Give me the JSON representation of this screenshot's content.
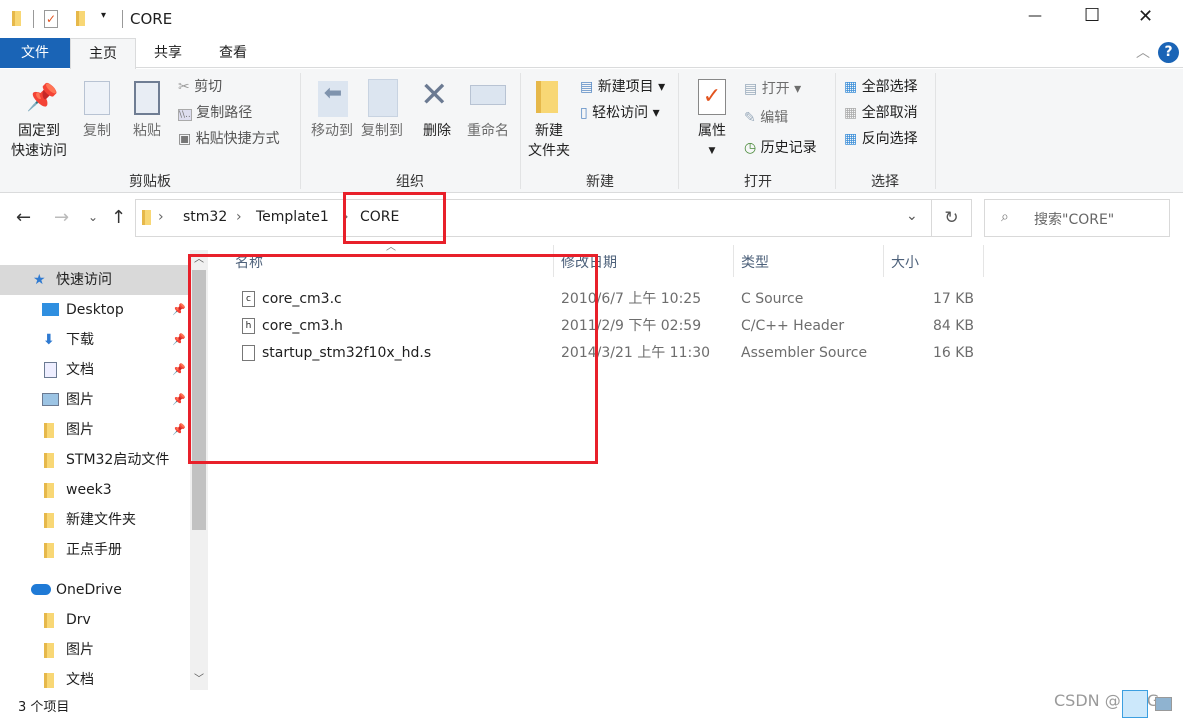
{
  "window": {
    "title": "CORE",
    "minimize": "—",
    "maximize": "☐",
    "close": "✕"
  },
  "tabs": {
    "file": "文件",
    "home": "主页",
    "share": "共享",
    "view": "查看"
  },
  "ribbon": {
    "clipboard": {
      "pin": "固定到",
      "pin2": "快速访问",
      "copy": "复制",
      "paste": "粘贴",
      "cut": "剪切",
      "copy_path": "复制路径",
      "paste_shortcut": "粘贴快捷方式",
      "label": "剪贴板"
    },
    "organize": {
      "move_to": "移动到",
      "copy_to": "复制到",
      "delete": "删除",
      "rename": "重命名",
      "label": "组织"
    },
    "new": {
      "new_folder": "新建",
      "new_folder2": "文件夹",
      "new_item": "新建项目",
      "easy_access": "轻松访问",
      "label": "新建"
    },
    "open": {
      "properties": "属性",
      "open": "打开",
      "edit": "编辑",
      "history": "历史记录",
      "label": "打开"
    },
    "select": {
      "select_all": "全部选择",
      "select_none": "全部取消",
      "invert": "反向选择",
      "label": "选择"
    }
  },
  "address": {
    "crumbs": [
      "stm32",
      "Template1",
      "CORE"
    ],
    "search_placeholder": "搜索\"CORE\""
  },
  "columns": {
    "name": "名称",
    "modified": "修改日期",
    "type": "类型",
    "size": "大小"
  },
  "files": [
    {
      "name": "core_cm3.c",
      "modified": "2010/6/7 上午 10:25",
      "type": "C Source",
      "size": "17 KB",
      "icon": "c-file-icon"
    },
    {
      "name": "core_cm3.h",
      "modified": "2011/2/9 下午 02:59",
      "type": "C/C++ Header",
      "size": "84 KB",
      "icon": "h-file-icon"
    },
    {
      "name": "startup_stm32f10x_hd.s",
      "modified": "2014/3/21 上午 11:30",
      "type": "Assembler Source",
      "size": "16 KB",
      "icon": "file-icon"
    }
  ],
  "sidebar": {
    "quick_access": "快速访问",
    "items": [
      {
        "label": "Desktop",
        "pinned": true,
        "icon": "desktop-icon"
      },
      {
        "label": "下载",
        "pinned": true,
        "icon": "download-icon"
      },
      {
        "label": "文档",
        "pinned": true,
        "icon": "document-icon"
      },
      {
        "label": "图片",
        "pinned": true,
        "icon": "pictures-icon"
      },
      {
        "label": "图片",
        "pinned": true,
        "icon": "folder-icon"
      },
      {
        "label": "STM32启动文件",
        "icon": "folder-icon"
      },
      {
        "label": "week3",
        "icon": "folder-icon"
      },
      {
        "label": "新建文件夹",
        "icon": "folder-icon"
      },
      {
        "label": "正点手册",
        "icon": "folder-icon"
      }
    ],
    "onedrive": "OneDrive",
    "onedrive_items": [
      {
        "label": "Drv"
      },
      {
        "label": "图片"
      },
      {
        "label": "文档"
      }
    ]
  },
  "status": {
    "count": "3 个项目"
  },
  "watermark": "CSDN @L_FG",
  "colors": {
    "accent": "#1a64b6",
    "annotation": "#e8202a",
    "folder": "#f8d775"
  }
}
